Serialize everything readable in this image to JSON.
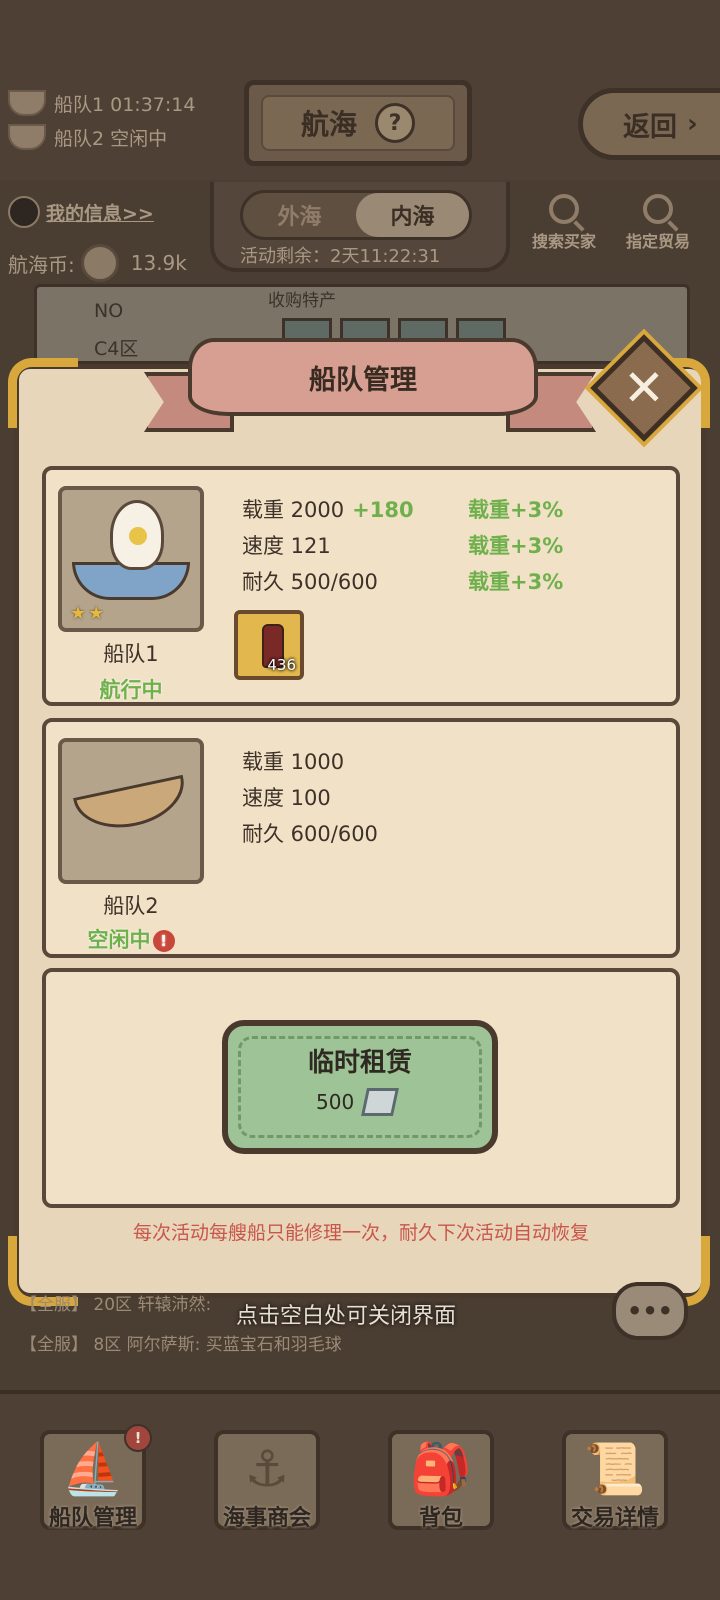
{
  "header": {
    "fleet_status": [
      "船队1 01:37:14",
      "船队2 空闲中"
    ],
    "title": "航海",
    "help_glyph": "?",
    "back_label": "返回",
    "back_arrow": "›",
    "my_info": "我的信息>>",
    "coin_label": "航海币:",
    "coin_value": "13.9k",
    "sea_tabs": [
      "外海",
      "内海"
    ],
    "active_sea_tab": "内海",
    "event_remaining": "活动剩余：2天11:22:31",
    "search_buyer": "搜索买家",
    "designated_trade": "指定贸易"
  },
  "region": {
    "no_label": "NO",
    "zone": "C4区",
    "purchase_label": "收购特产"
  },
  "modal": {
    "title": "船队管理",
    "close_glyph": "✕",
    "fleets": [
      {
        "name": "船队1",
        "status": "航行中",
        "stars": "★★",
        "stats": [
          {
            "label": "载重 2000",
            "bonus": "+180"
          },
          {
            "label": "速度 121",
            "bonus": ""
          },
          {
            "label": "耐久 500/600",
            "bonus": ""
          }
        ],
        "buffs": [
          "载重+3%",
          "载重+3%",
          "载重+3%"
        ],
        "cargo_count": "436"
      },
      {
        "name": "船队2",
        "status": "空闲中",
        "warning_glyph": "!",
        "stats": [
          {
            "label": "载重 1000"
          },
          {
            "label": "速度 100"
          },
          {
            "label": "耐久 600/600"
          }
        ]
      }
    ],
    "rent": {
      "label": "临时租赁",
      "cost": "500"
    },
    "notice": "每次活动每艘船只能修理一次，耐久下次活动自动恢复"
  },
  "chat": {
    "lines": [
      {
        "channel": "【全服】",
        "text": "20区 轩辕沛然:"
      },
      {
        "channel": "【全服】",
        "text": "8区 阿尔萨斯: 买蓝宝石和羽毛球"
      }
    ],
    "close_hint": "点击空白处可关闭界面",
    "bubble_glyph": "•••"
  },
  "nav": {
    "items": [
      {
        "label": "船队管理",
        "glyph": "⛵",
        "badge": "!"
      },
      {
        "label": "海事商会",
        "glyph": "⚓"
      },
      {
        "label": "背包",
        "glyph": "🎒"
      },
      {
        "label": "交易详情",
        "glyph": "📜"
      }
    ]
  }
}
